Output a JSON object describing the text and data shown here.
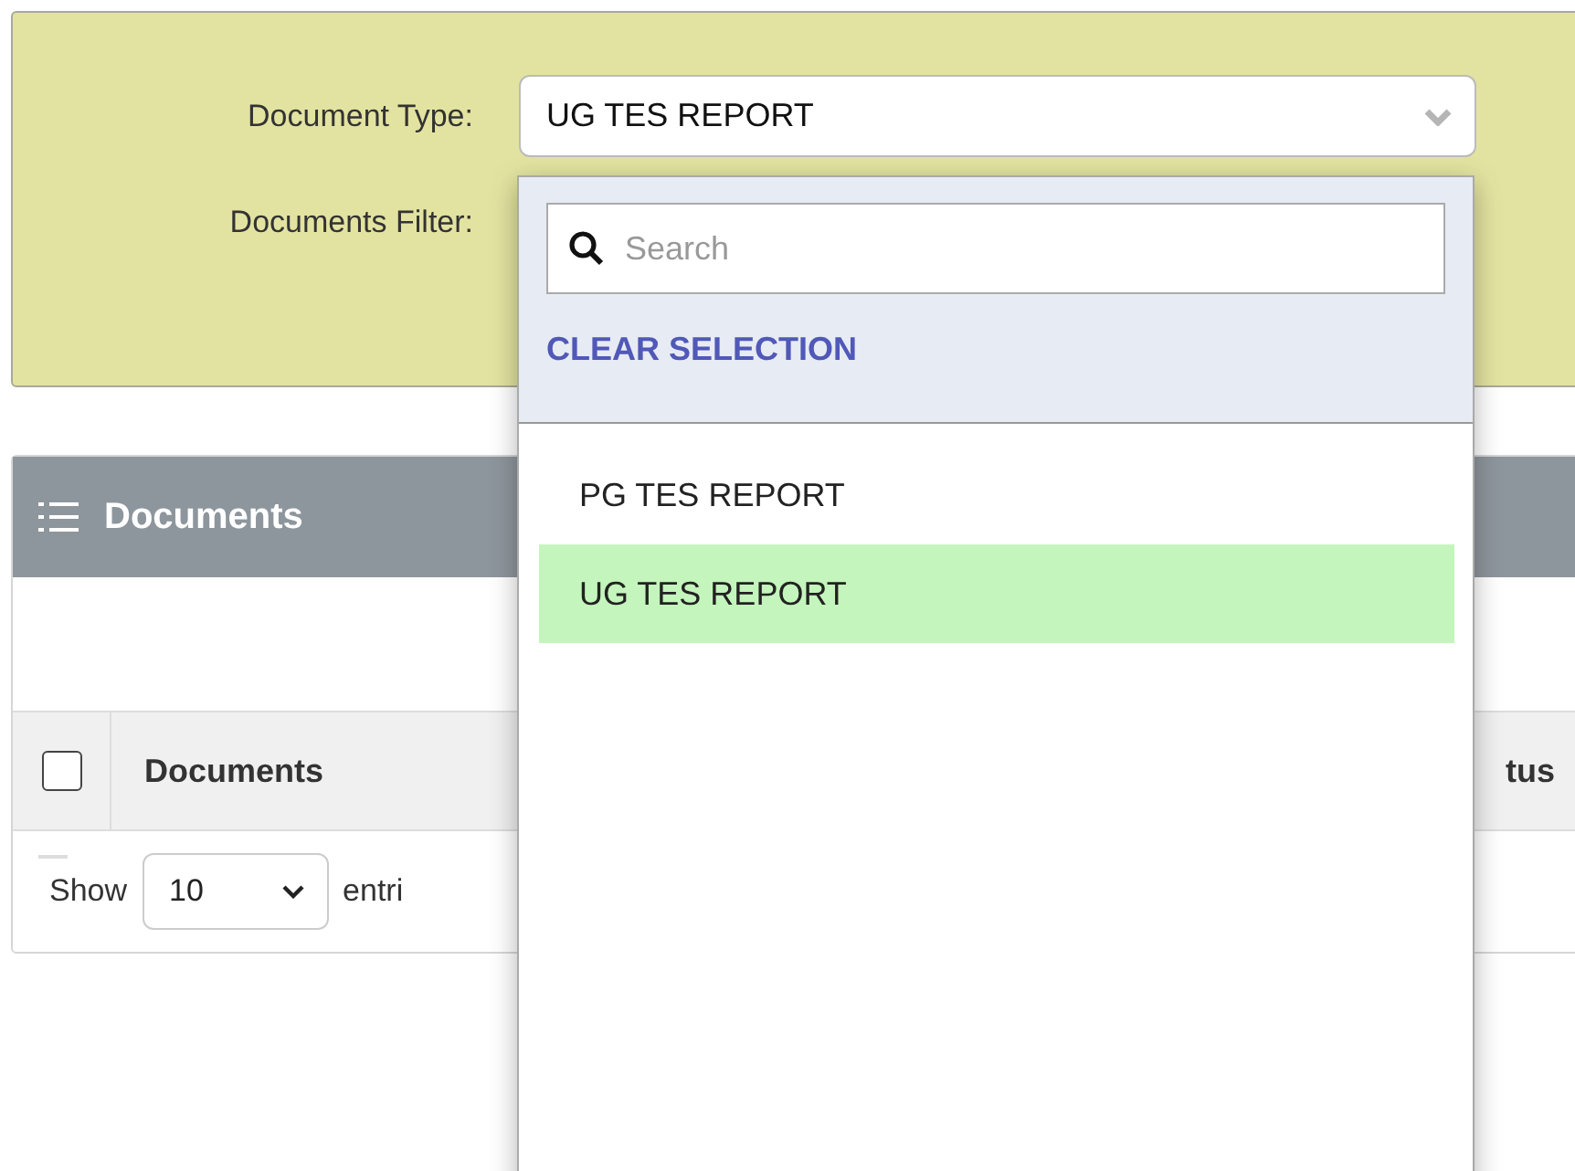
{
  "filters": [
    {
      "label": "Document Type:",
      "value": "UG TES REPORT"
    },
    {
      "label": "Documents Filter:"
    }
  ],
  "dropdown": {
    "search": {
      "placeholder": "Search"
    },
    "clear": "CLEAR SELECTION",
    "options": [
      {
        "label": "PG TES REPORT",
        "selected": false
      },
      {
        "label": "UG TES REPORT",
        "selected": true
      }
    ]
  },
  "panel": {
    "title": "Documents",
    "columns": [
      "Documents",
      "tus"
    ],
    "select_all_checked": false,
    "footer": {
      "show": "Show",
      "page_size": "10",
      "entries": "entri"
    }
  }
}
